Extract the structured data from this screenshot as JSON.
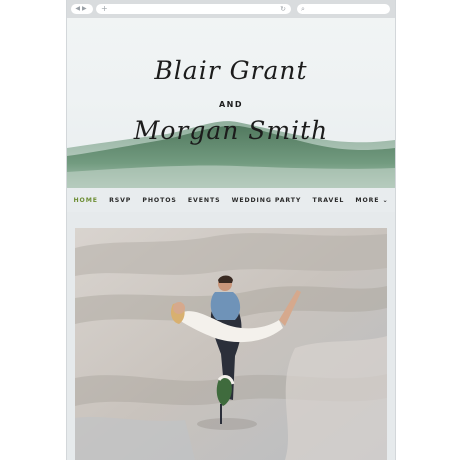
{
  "browser": {
    "back_icon": "back-arrow-icon",
    "forward_icon": "forward-arrow-icon",
    "new_tab_icon": "plus-icon",
    "reload_icon": "reload-icon",
    "search_icon": "search-icon"
  },
  "hero": {
    "name_one": "Blair Grant",
    "connector": "AND",
    "name_two": "Morgan Smith",
    "colors": {
      "mountain": "#5e8a6b",
      "mountain_dark": "#4b7358",
      "sky": "#eef2f3"
    }
  },
  "nav": {
    "active_color": "#6f8f36",
    "items": [
      {
        "label": "HOME",
        "active": true
      },
      {
        "label": "RSVP",
        "active": false
      },
      {
        "label": "PHOTOS",
        "active": false
      },
      {
        "label": "EVENTS",
        "active": false
      },
      {
        "label": "WEDDING PARTY",
        "active": false
      },
      {
        "label": "TRAVEL",
        "active": false
      },
      {
        "label": "MORE ⌄",
        "active": false
      }
    ]
  }
}
